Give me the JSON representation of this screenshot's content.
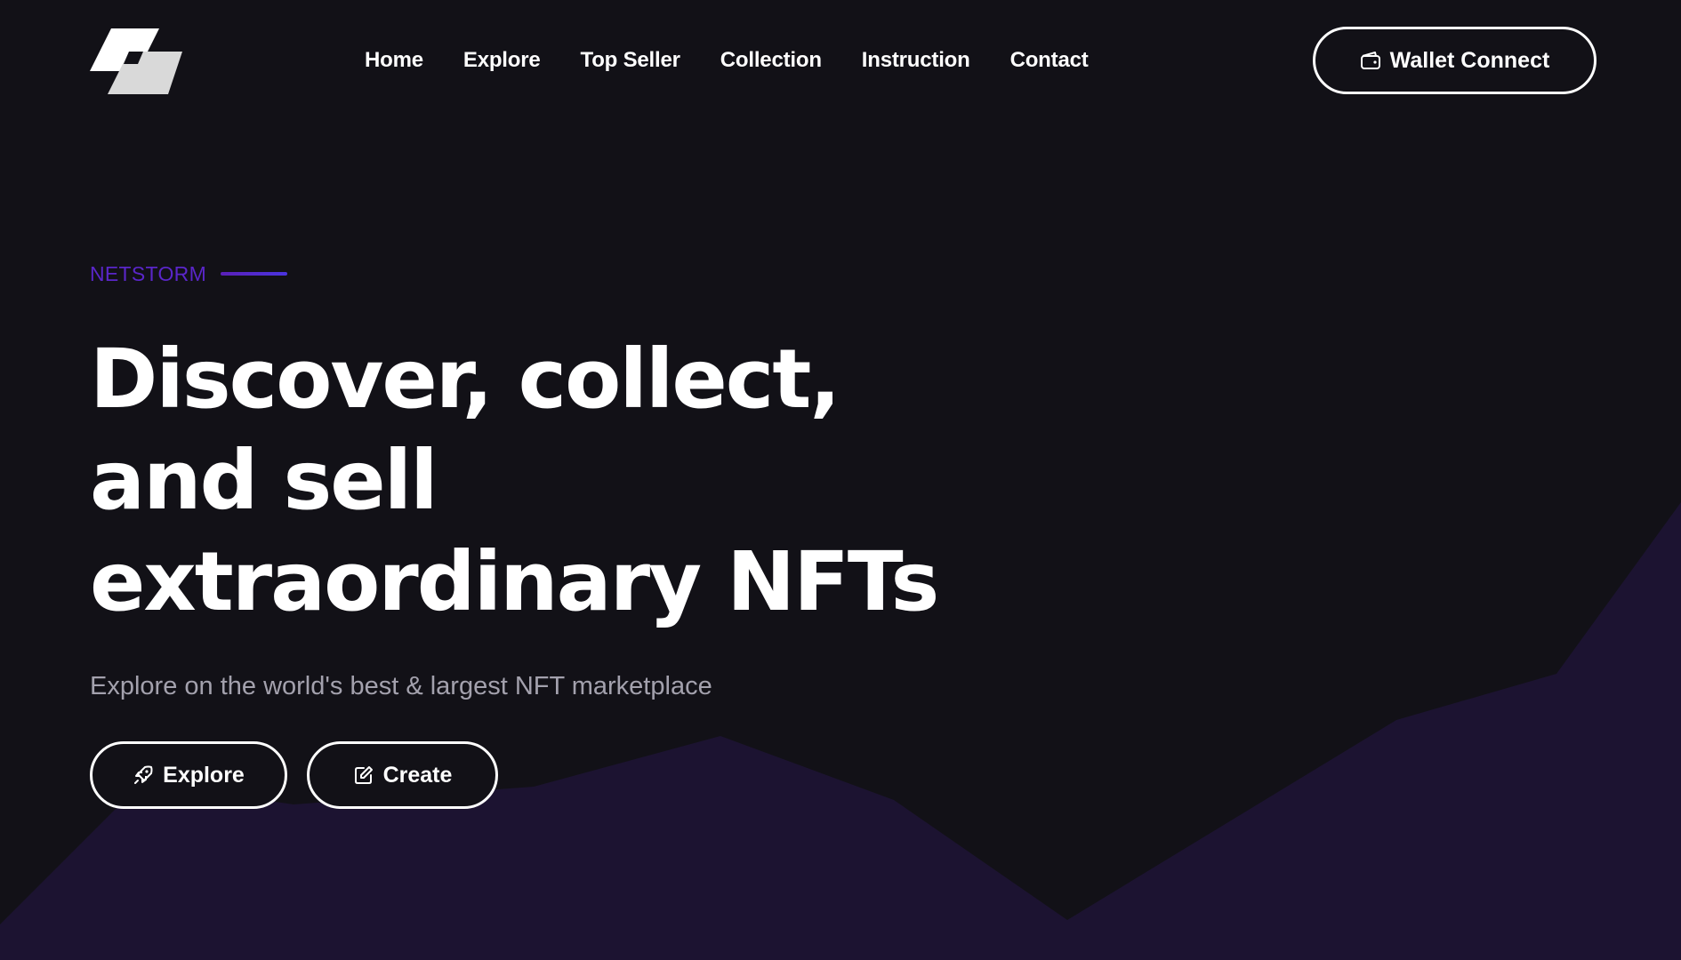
{
  "colors": {
    "background": "#121117",
    "accent": "#5a26c9",
    "mountain": "#1d1433",
    "text_primary": "#ffffff",
    "text_muted": "#a3a1ad"
  },
  "header": {
    "logo_icon": "netstorm-logo-icon",
    "nav": [
      {
        "label": "Home"
      },
      {
        "label": "Explore"
      },
      {
        "label": "Top Seller"
      },
      {
        "label": "Collection"
      },
      {
        "label": "Instruction"
      },
      {
        "label": "Contact"
      }
    ],
    "wallet_button": {
      "label": "Wallet Connect",
      "icon": "wallet-icon"
    }
  },
  "hero": {
    "eyebrow": "NETSTORM",
    "headline_lines": [
      "Discover, collect,",
      "and sell",
      "extraordinary NFTs"
    ],
    "subtitle": "Explore on the world's best & largest NFT marketplace",
    "buttons": [
      {
        "label": "Explore",
        "icon": "rocket-icon"
      },
      {
        "label": "Create",
        "icon": "edit-icon"
      }
    ]
  }
}
